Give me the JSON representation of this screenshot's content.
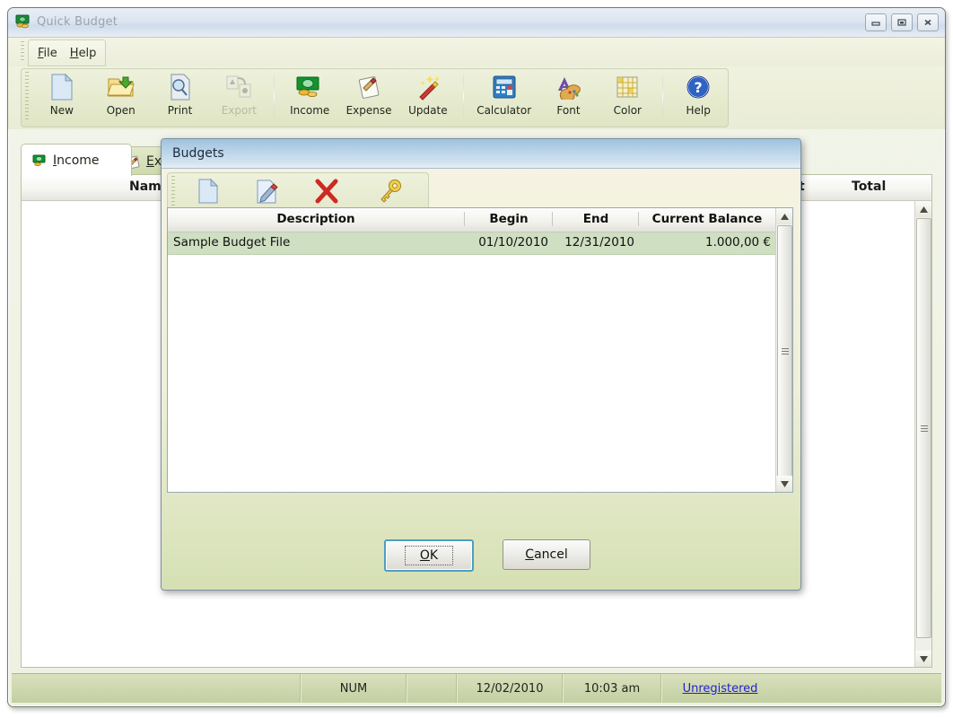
{
  "window": {
    "title": "Quick Budget",
    "icon": "money-stack-icon",
    "buttons": {
      "minimize": "Minimize",
      "maximize": "Maximize",
      "close": "Close"
    }
  },
  "menu": {
    "items": [
      {
        "label": "File",
        "mnemonic": "F"
      },
      {
        "label": "Help",
        "mnemonic": "H"
      }
    ]
  },
  "toolbar": {
    "items": [
      {
        "label": "New",
        "icon": "new-page-icon",
        "disabled": false
      },
      {
        "label": "Open",
        "icon": "open-folder-icon",
        "disabled": false
      },
      {
        "label": "Print",
        "icon": "print-icon",
        "disabled": false
      },
      {
        "label": "Export",
        "icon": "export-icon",
        "disabled": true
      },
      {
        "label": "Income",
        "icon": "banknote-icon",
        "disabled": false
      },
      {
        "label": "Expense",
        "icon": "clipboard-pen-icon",
        "disabled": false
      },
      {
        "label": "Update",
        "icon": "magic-wand-icon",
        "disabled": false
      },
      {
        "label": "Calculator",
        "icon": "calculator-icon",
        "disabled": false
      },
      {
        "label": "Font",
        "icon": "font-palette-icon",
        "disabled": false
      },
      {
        "label": "Color",
        "icon": "color-grid-icon",
        "disabled": false
      },
      {
        "label": "Help",
        "icon": "question-help-icon",
        "disabled": false
      }
    ]
  },
  "tabs": [
    {
      "label": "Income",
      "mnemonic": "I",
      "icon": "banknote-icon",
      "active": true
    },
    {
      "label": "Expense",
      "mnemonic": "E",
      "icon": "clipboard-pen-icon",
      "active": false
    }
  ],
  "main_grid": {
    "columns": [
      "Name",
      "Amount",
      "Total"
    ],
    "visible_headers": {
      "name": "Name",
      "amount": "nt",
      "total": "Total"
    },
    "rows": []
  },
  "dialog": {
    "title": "Budgets",
    "toolbar": [
      {
        "label": "New",
        "icon": "new-page-icon"
      },
      {
        "label": "Edit",
        "icon": "edit-pencil-icon"
      },
      {
        "label": "Delete",
        "icon": "delete-x-icon"
      },
      {
        "label": "Password",
        "icon": "key-icon"
      }
    ],
    "grid": {
      "columns": [
        "Description",
        "Begin",
        "End",
        "Current Balance"
      ],
      "rows": [
        {
          "description": "Sample Budget File",
          "begin": "01/10/2010",
          "end": "12/31/2010",
          "current_balance": "1.000,00 €",
          "selected": true
        }
      ]
    },
    "buttons": [
      {
        "label": "OK",
        "mnemonic": "O",
        "default": true
      },
      {
        "label": "Cancel",
        "mnemonic": "C",
        "default": false
      }
    ]
  },
  "statusbar": {
    "panes": [
      {
        "name": "message",
        "text": ""
      },
      {
        "name": "num-lock",
        "text": "NUM"
      },
      {
        "name": "blank",
        "text": ""
      },
      {
        "name": "date",
        "text": "12/02/2010"
      },
      {
        "name": "time",
        "text": "10:03 am"
      },
      {
        "name": "registration",
        "text": "Unregistered",
        "link": true
      }
    ]
  },
  "colors": {
    "accent_green": "#c3cfa2",
    "title_blue": "#b9d3e8",
    "selection_green": "#cfdfc2",
    "link_blue": "#2222cc"
  }
}
